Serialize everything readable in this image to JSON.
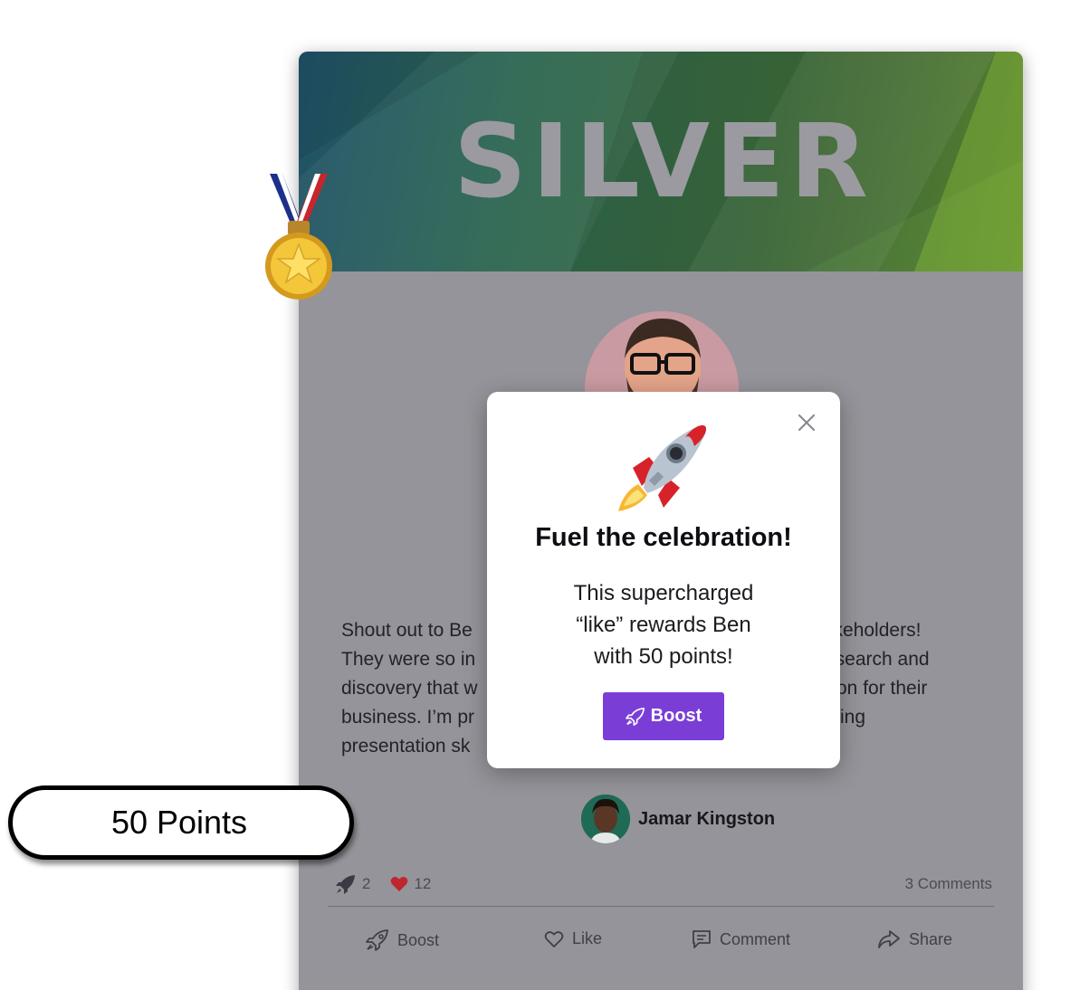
{
  "banner": {
    "level": "SILVER"
  },
  "post": {
    "text_lines": [
      "Shout out to Be",
      "They were so in",
      "discovery that w",
      "business. I’m pr",
      "presentation sk"
    ],
    "text_lines_right": [
      "takeholders!",
      "esearch and",
      "on for their",
      "ing",
      ""
    ],
    "author": "Jamar Kingston"
  },
  "stats": {
    "boosts": "2",
    "likes": "12",
    "comments": "3 Comments"
  },
  "actions": {
    "boost": "Boost",
    "like": "Like",
    "comment": "Comment",
    "share": "Share"
  },
  "points_badge": "50 Points",
  "modal": {
    "title": "Fuel the celebration!",
    "body_lines": [
      "This supercharged",
      "“like” rewards Ben",
      "with 50 points!"
    ],
    "button": "Boost"
  },
  "colors": {
    "accent": "#7a3ed6",
    "heart": "#c0262e",
    "card_overlay": "#94949a"
  },
  "icons": [
    "medal-icon",
    "rocket-icon",
    "close-icon",
    "rocket-outline-icon",
    "heart-icon",
    "comment-icon",
    "share-icon"
  ]
}
